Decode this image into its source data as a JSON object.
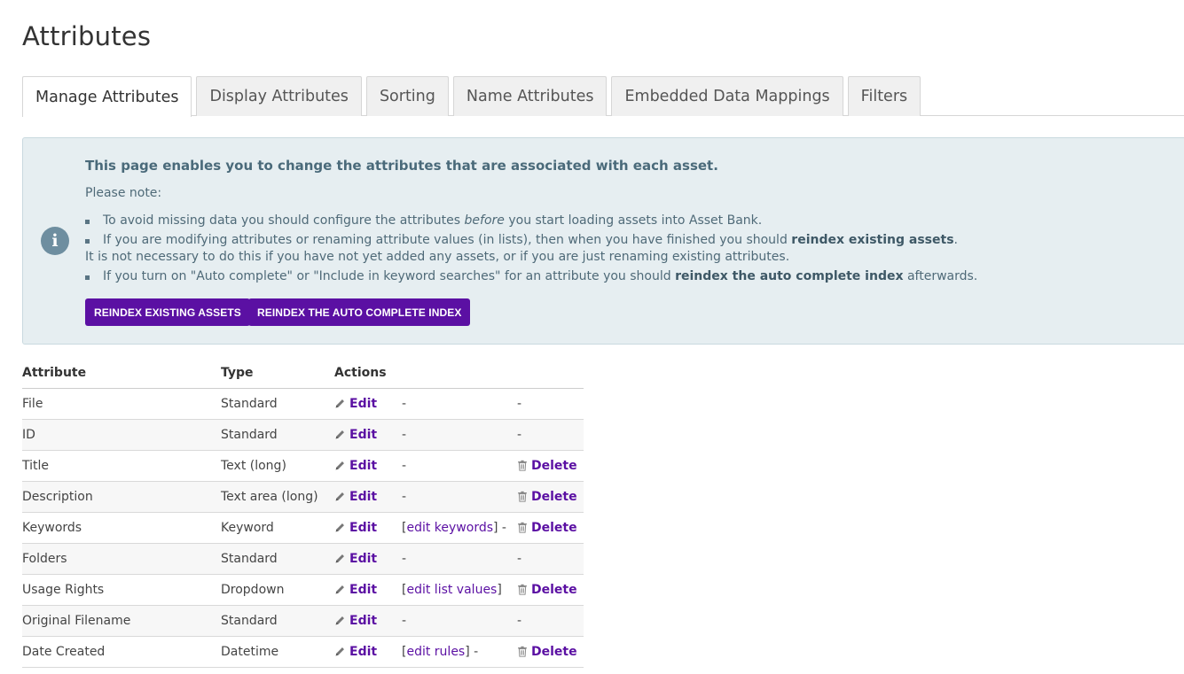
{
  "page": {
    "title": "Attributes"
  },
  "tabs": [
    {
      "label": "Manage Attributes",
      "active": true
    },
    {
      "label": "Display Attributes",
      "active": false
    },
    {
      "label": "Sorting",
      "active": false
    },
    {
      "label": "Name Attributes",
      "active": false
    },
    {
      "label": "Embedded Data Mappings",
      "active": false
    },
    {
      "label": "Filters",
      "active": false
    }
  ],
  "info": {
    "icon": "info-icon",
    "heading": "This page enables you to change the attributes that are associated with each asset.",
    "note": "Please note:",
    "bullet1": {
      "pre": "To avoid missing data you should configure the attributes ",
      "em": "before",
      "post": " you start loading assets into Asset Bank."
    },
    "bullet2": {
      "pre": "If you are modifying attributes or renaming attribute values (in lists), then when you have finished you should ",
      "bold": "reindex existing assets",
      "post": "."
    },
    "line2": "It is not necessary to do this if you have not yet added any assets, or if you are just renaming existing attributes.",
    "bullet3": {
      "pre": "If you turn on \"Auto complete\" or \"Include in keyword searches\" for an attribute you should ",
      "bold": "reindex the auto complete index",
      "post": " afterwards."
    },
    "buttons": {
      "reindex_assets": "REINDEX EXISTING ASSETS",
      "reindex_autocomplete": "REINDEX THE AUTO COMPLETE INDEX"
    }
  },
  "table": {
    "headers": {
      "attribute": "Attribute",
      "type": "Type",
      "actions": "Actions"
    },
    "edit_label": "Edit",
    "delete_label": "Delete",
    "dash": "-",
    "rows": [
      {
        "attribute": "File",
        "type": "Standard",
        "extra_link": "",
        "delete": false
      },
      {
        "attribute": "ID",
        "type": "Standard",
        "extra_link": "",
        "delete": false
      },
      {
        "attribute": "Title",
        "type": "Text (long)",
        "extra_link": "",
        "delete": true
      },
      {
        "attribute": "Description",
        "type": "Text area (long)",
        "extra_link": "",
        "delete": true
      },
      {
        "attribute": "Keywords",
        "type": "Keyword",
        "extra_link": "edit keywords",
        "extra_suffix": " -",
        "delete": true
      },
      {
        "attribute": "Folders",
        "type": "Standard",
        "extra_link": "",
        "delete": false
      },
      {
        "attribute": "Usage Rights",
        "type": "Dropdown",
        "extra_link": "edit list values",
        "extra_suffix": "",
        "delete": true
      },
      {
        "attribute": "Original Filename",
        "type": "Standard",
        "extra_link": "",
        "delete": false
      },
      {
        "attribute": "Date Created",
        "type": "Datetime",
        "extra_link": "edit rules",
        "extra_suffix": " -",
        "delete": true
      }
    ]
  },
  "colors": {
    "accent": "#5b10a3",
    "info_bg": "#e6eef1",
    "info_text": "#4f6a78"
  }
}
